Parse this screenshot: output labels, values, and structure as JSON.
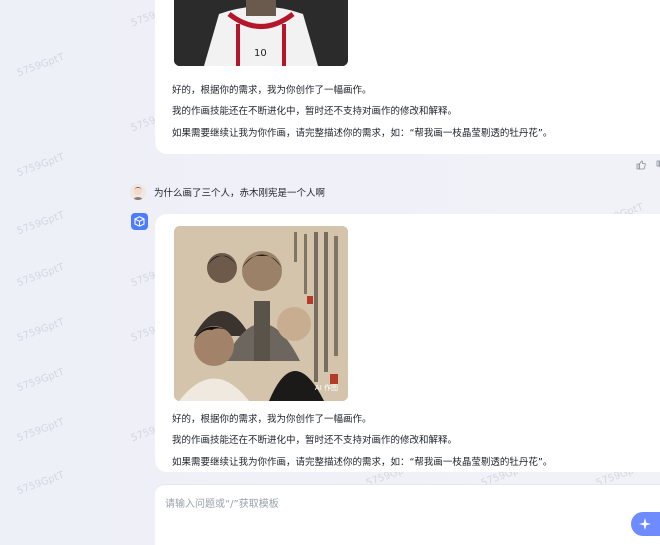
{
  "conversation": {
    "reply1": {
      "line1": "好的，根据你的需求，我为你创作了一幅画作。",
      "line2": "我的作画技能还在不断进化中，暂时还不支持对画作的修改和解释。",
      "line3": "如果需要继续让我为你作画，请完整描述你的需求，如：“帮我画一枝晶莹剔透的牡丹花”。"
    },
    "user_message": "为什么画了三个人，赤木刚宪是一个人啊",
    "reply2": {
      "image_tag": "AI 作图",
      "line1": "好的，根据你的需求，我为你创作了一幅画作。",
      "line2": "我的作画技能还在不断进化中，暂时还不支持对画作的修改和解释。",
      "line3": "如果需要继续让我为你作画，请完整描述你的需求，如：“帮我画一枝晶莹剔透的牡丹花”。"
    }
  },
  "input": {
    "placeholder": "请输入问题或“/”获取模板"
  },
  "watermark": "5759GptT",
  "colors": {
    "accent": "#4f7cff",
    "send_button": "#6e8bff",
    "background": "#eef0f7"
  }
}
